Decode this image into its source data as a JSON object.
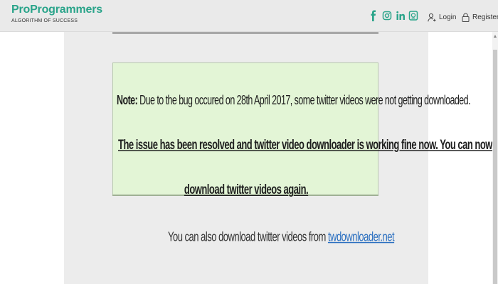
{
  "header": {
    "logo_title": "ProProgrammers",
    "logo_tagline": "ALGORITHM OF SUCCESS",
    "social_icons": [
      "facebook-icon",
      "instagram-icon",
      "linkedin-icon",
      "whatsapp-icon"
    ],
    "login_label": "Login",
    "register_label": "Register"
  },
  "notice": {
    "note_label": "Note:",
    "note_text": "Due to the bug occured on 28th April 2017, some twitter videos were not getting downloaded.",
    "resolved_line1": "The issue has been resolved and twitter video downloader is working fine now. You can now",
    "resolved_line2": "download twitter videos again."
  },
  "also": {
    "text": "You can also download twitter videos from ",
    "link": "twdownloader.net"
  },
  "colors": {
    "brand": "#2aa48a",
    "notice_bg": "#e3f5d6",
    "link": "#2a6fc0"
  }
}
